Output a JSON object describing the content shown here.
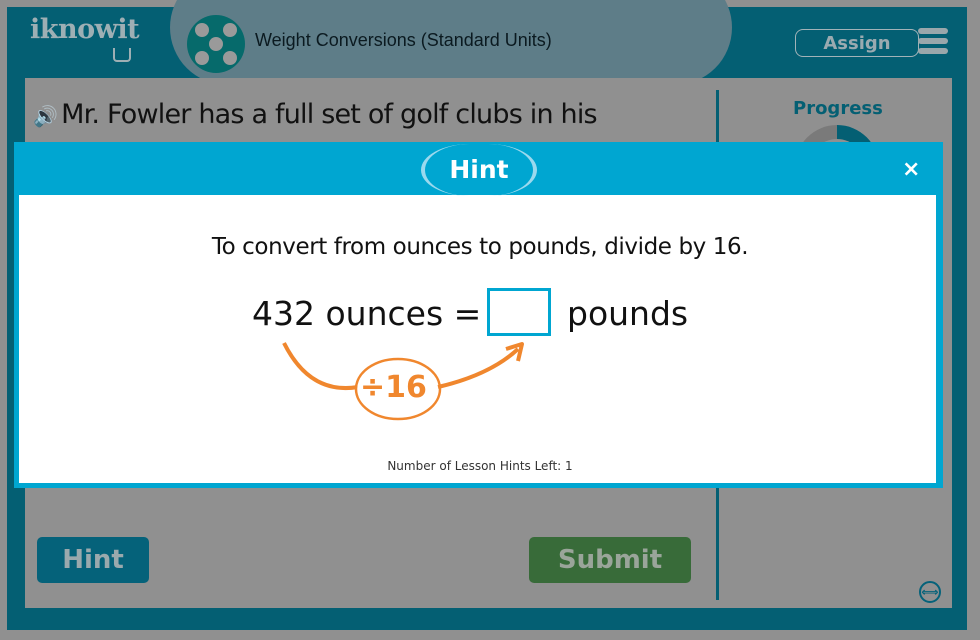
{
  "header": {
    "logo": "iknowit",
    "lesson_title": "Weight Conversions (Standard Units)",
    "assign_label": "Assign",
    "menu_icon": "hamburger-menu-icon"
  },
  "question": {
    "speaker_icon": "speaker-icon",
    "text": "Mr. Fowler has a full set of golf clubs in his"
  },
  "sidebar": {
    "progress_label": "Progress",
    "progress_fraction": 0.25
  },
  "buttons": {
    "hint": "Hint",
    "submit": "Submit",
    "expand_icon": "expand-arrows-icon"
  },
  "modal": {
    "title": "Hint",
    "close": "×",
    "instruction": "To convert from ounces to pounds, divide by 16.",
    "equation_left": "432 ounces =",
    "equation_right": "pounds",
    "answer_value": "",
    "divisor": "÷16",
    "hints_left": "Number of Lesson Hints Left: 1"
  },
  "colors": {
    "frame": "#045f73",
    "modal_accent": "#00a6d1",
    "arrow": "#f0872e",
    "submit": "#386b39"
  }
}
